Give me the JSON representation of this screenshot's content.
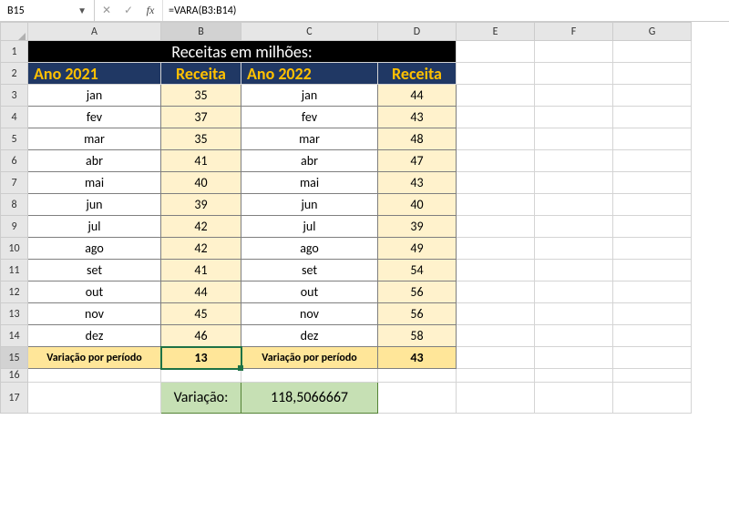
{
  "nameBox": "B15",
  "formula": "=VARA(B3:B14)",
  "columns": [
    "A",
    "B",
    "C",
    "D",
    "E",
    "F",
    "G"
  ],
  "selectedCol": "B",
  "selectedRow": 15,
  "title": "Receitas em milhões:",
  "headers": {
    "a": "Ano 2021",
    "b": "Receita",
    "c": "Ano 2022",
    "d": "Receita"
  },
  "rows": [
    {
      "m1": "jan",
      "v1": "35",
      "m2": "jan",
      "v2": "44"
    },
    {
      "m1": "fev",
      "v1": "37",
      "m2": "fev",
      "v2": "43"
    },
    {
      "m1": "mar",
      "v1": "35",
      "m2": "mar",
      "v2": "48"
    },
    {
      "m1": "abr",
      "v1": "41",
      "m2": "abr",
      "v2": "47"
    },
    {
      "m1": "mai",
      "v1": "40",
      "m2": "mai",
      "v2": "43"
    },
    {
      "m1": "jun",
      "v1": "39",
      "m2": "jun",
      "v2": "40"
    },
    {
      "m1": "jul",
      "v1": "42",
      "m2": "jul",
      "v2": "39"
    },
    {
      "m1": "ago",
      "v1": "42",
      "m2": "ago",
      "v2": "49"
    },
    {
      "m1": "set",
      "v1": "41",
      "m2": "set",
      "v2": "54"
    },
    {
      "m1": "out",
      "v1": "44",
      "m2": "out",
      "v2": "56"
    },
    {
      "m1": "nov",
      "v1": "45",
      "m2": "nov",
      "v2": "56"
    },
    {
      "m1": "dez",
      "v1": "46",
      "m2": "dez",
      "v2": "58"
    }
  ],
  "varLabel1": "Variação por período",
  "varVal1": "13",
  "varLabel2": "Variação por período",
  "varVal2": "43",
  "bottomLabel": "Variação:",
  "bottomVal": "118,5066667",
  "chart_data": {
    "type": "table",
    "title": "Receitas em milhões:",
    "series": [
      {
        "name": "Ano 2021 Receita",
        "categories": [
          "jan",
          "fev",
          "mar",
          "abr",
          "mai",
          "jun",
          "jul",
          "ago",
          "set",
          "out",
          "nov",
          "dez"
        ],
        "values": [
          35,
          37,
          35,
          41,
          40,
          39,
          42,
          42,
          41,
          44,
          45,
          46
        ]
      },
      {
        "name": "Ano 2022 Receita",
        "categories": [
          "jan",
          "fev",
          "mar",
          "abr",
          "mai",
          "jun",
          "jul",
          "ago",
          "set",
          "out",
          "nov",
          "dez"
        ],
        "values": [
          44,
          43,
          48,
          47,
          43,
          40,
          39,
          49,
          54,
          56,
          56,
          58
        ]
      }
    ],
    "summary": {
      "Variação por período 2021": 13,
      "Variação por período 2022": 43,
      "Variação": 118.5066667
    }
  }
}
